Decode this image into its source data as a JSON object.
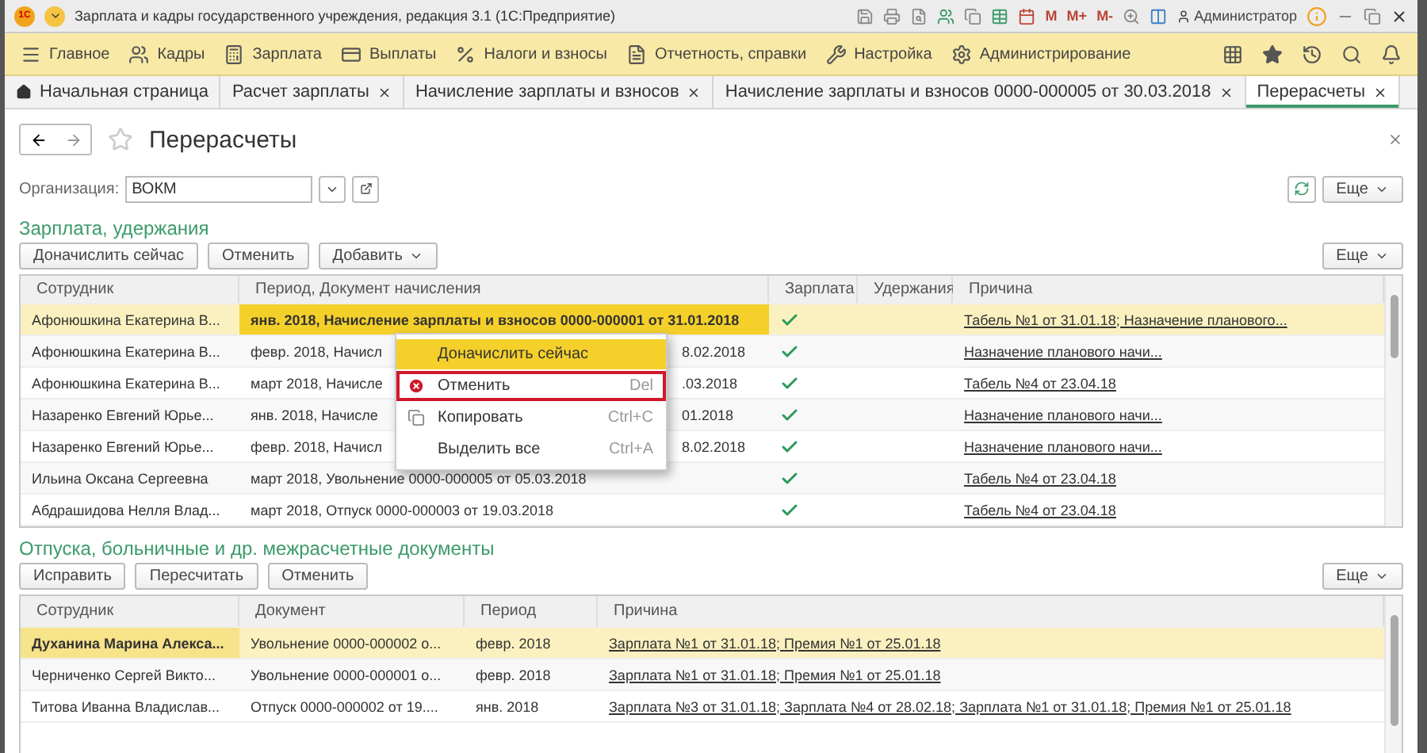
{
  "window": {
    "logo": "1С",
    "title": "Зарплата и кадры государственного учреждения, редакция 3.1  (1С:Предприятие)",
    "memory_buttons": [
      "M",
      "M+",
      "M-"
    ],
    "user": "Администратор"
  },
  "sections_menu": [
    {
      "label": "Главное"
    },
    {
      "label": "Кадры"
    },
    {
      "label": "Зарплата"
    },
    {
      "label": "Выплаты"
    },
    {
      "label": "Налоги и взносы"
    },
    {
      "label": "Отчетность, справки"
    },
    {
      "label": "Настройка"
    },
    {
      "label": "Администрирование"
    }
  ],
  "tabs": [
    {
      "kind": "home",
      "label": "Начальная страница",
      "selected": false
    },
    {
      "kind": "page",
      "label": "Расчет зарплаты",
      "selected": false
    },
    {
      "kind": "page",
      "label": "Начисление зарплаты и взносов",
      "selected": false
    },
    {
      "kind": "page",
      "label": "Начисление зарплаты и взносов 0000-000005 от 30.03.2018",
      "selected": false
    },
    {
      "kind": "page",
      "label": "Перерасчеты",
      "selected": true
    }
  ],
  "page": {
    "title": "Перерасчеты",
    "more_button": "Еще"
  },
  "organization": {
    "label": "Организация:",
    "value": "ВОКМ"
  },
  "payroll": {
    "title": "Зарплата, удержания",
    "more_button": "Еще",
    "buttons": [
      {
        "label": "Доначислить сейчас",
        "dropdown": false
      },
      {
        "label": "Отменить",
        "dropdown": false
      },
      {
        "label": "Добавить",
        "dropdown": true
      }
    ],
    "columns": [
      "Сотрудник",
      "Период, Документ начисления",
      "Зарплата",
      "Удержания",
      "Причина"
    ],
    "rows": [
      {
        "employee": "Афонюшкина Екатерина В...",
        "period": "янв. 2018, Начисление зарплаты и взносов 0000-000001 от 31.01.2018",
        "salary": true,
        "deductions": false,
        "reason": "Табель №1 от 31.01.18; Назначение планового...",
        "selected": true,
        "period_active": true
      },
      {
        "employee": "Афонюшкина Екатерина В...",
        "period": "февр. 2018, Начисл",
        "period_tail": "8.02.2018",
        "salary": true,
        "deductions": false,
        "reason": "Назначение планового начи...",
        "selected": false,
        "period_active": false
      },
      {
        "employee": "Афонюшкина Екатерина В...",
        "period": "март 2018, Начисле",
        "period_tail": ".03.2018",
        "salary": true,
        "deductions": false,
        "reason": "Табель №4 от 23.04.18",
        "selected": false,
        "period_active": false
      },
      {
        "employee": "Назаренко Евгений Юрье...",
        "period": "янв. 2018, Начисле",
        "period_tail": "01.2018",
        "salary": true,
        "deductions": false,
        "reason": "Назначение планового начи...",
        "selected": false,
        "period_active": false
      },
      {
        "employee": "Назаренко Евгений Юрье...",
        "period": "февр. 2018, Начисл",
        "period_tail": "8.02.2018",
        "salary": true,
        "deductions": false,
        "reason": "Назначение планового начи...",
        "selected": false,
        "period_active": false
      },
      {
        "employee": "Ильина Оксана Сергеевна",
        "period": "март 2018, Увольнение 0000-000005 от 05.03.2018",
        "salary": true,
        "deductions": false,
        "reason": "Табель №4 от 23.04.18",
        "selected": false,
        "period_active": false
      },
      {
        "employee": "Абдрашидова Нелля Влад...",
        "period": "март 2018, Отпуск 0000-000003 от 19.03.2018",
        "salary": true,
        "deductions": false,
        "reason": "Табель №4 от 23.04.18",
        "selected": false,
        "period_active": false
      }
    ]
  },
  "context_menu": {
    "items": [
      {
        "kind": "plain",
        "label": "Доначислить сейчас",
        "selected": true,
        "outlined": false
      },
      {
        "kind": "cancel",
        "label": "Отменить",
        "shortcut": "Del",
        "selected": false,
        "outlined": true
      },
      {
        "kind": "copy",
        "label": "Копировать",
        "shortcut": "Ctrl+C",
        "selected": false,
        "outlined": false
      },
      {
        "kind": "plain",
        "label": "Выделить все",
        "shortcut": "Ctrl+A",
        "selected": false,
        "outlined": false
      }
    ]
  },
  "documents": {
    "title": "Отпуска, больничные и др. межрасчетные документы",
    "more_button": "Еще",
    "buttons": [
      {
        "label": "Исправить",
        "dropdown": false
      },
      {
        "label": "Пересчитать",
        "dropdown": false
      },
      {
        "label": "Отменить",
        "dropdown": false
      }
    ],
    "columns": [
      "Сотрудник",
      "Документ",
      "Период",
      "Причина"
    ],
    "rows": [
      {
        "employee": "Духанина Марина Алекса...",
        "document": "Увольнение 0000-000002 о...",
        "period": "февр. 2018",
        "reason": "Зарплата №1 от 31.01.18; Премия №1 от 25.01.18",
        "selected": true,
        "employee_active": true
      },
      {
        "employee": "Черниченко Сергей Викто...",
        "document": "Увольнение 0000-000001 о...",
        "period": "февр. 2018",
        "reason": "Зарплата №1 от 31.01.18; Премия №1 от 25.01.18",
        "selected": false,
        "employee_active": false
      },
      {
        "employee": "Титова Иванна Владислав...",
        "document": "Отпуск 0000-000002 от 19....",
        "period": "янв. 2018",
        "reason": "Зарплата №3 от 31.01.18; Зарплата №4 от 28.02.18; Зарплата №1 от 31.01.18; Премия №1 от 25.01.18",
        "selected": false,
        "employee_active": false
      }
    ]
  }
}
